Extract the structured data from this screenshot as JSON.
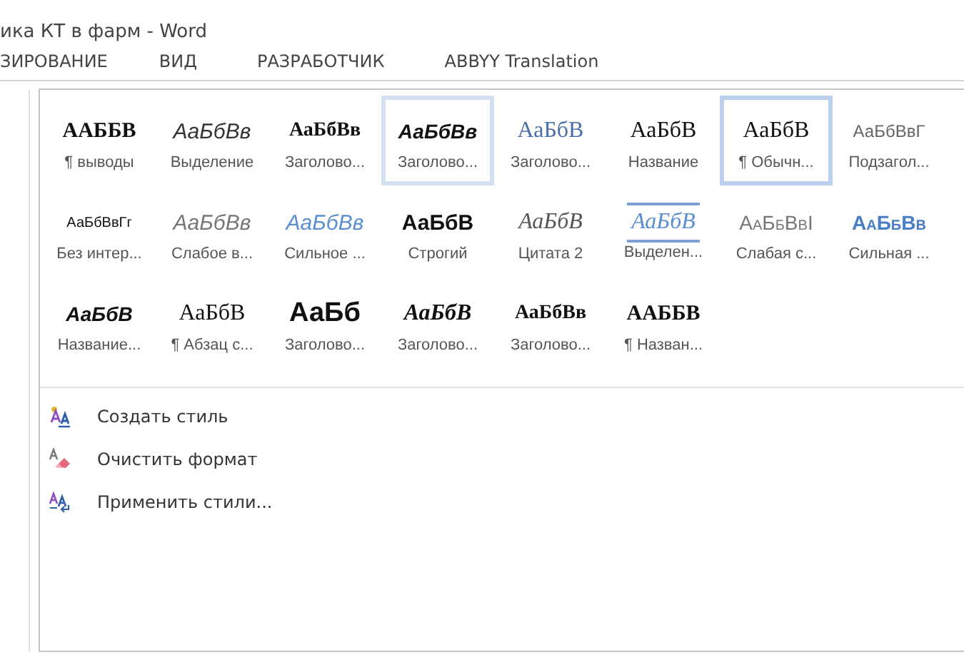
{
  "window": {
    "title": "ика КТ в фарм - Word"
  },
  "tabs": [
    {
      "label": "ЗИРОВАНИЕ",
      "selected": false
    },
    {
      "label": "ВИД",
      "selected": false
    },
    {
      "label": "РАЗРАБОТЧИК",
      "selected": false
    },
    {
      "label": "ABBYY Translation",
      "selected": false
    }
  ],
  "style_gallery": {
    "styles": [
      {
        "preview": "ААББВ",
        "label": "¶ выводы",
        "kind": "serifcaps",
        "selected": false,
        "hovered": false
      },
      {
        "preview": "АаБбВв",
        "label": "Выделение",
        "kind": "italic",
        "selected": false,
        "hovered": false
      },
      {
        "preview": "АаБбВв",
        "label": "Заголово...",
        "kind": "serifbold",
        "selected": false,
        "hovered": false
      },
      {
        "preview": "АаБбВв",
        "label": "Заголово...",
        "kind": "bolditalic",
        "selected": false,
        "hovered": true
      },
      {
        "preview": "АаБбВ",
        "label": "Заголово...",
        "kind": "serifblue",
        "selected": false,
        "hovered": false
      },
      {
        "preview": "АаБбВ",
        "label": "Название",
        "kind": "serif",
        "selected": false,
        "hovered": false
      },
      {
        "preview": "АаБбВ",
        "label": "¶ Обычн...",
        "kind": "serif",
        "selected": true,
        "hovered": false
      },
      {
        "preview": "АаБбВвГ",
        "label": "Подзагол...",
        "kind": "sansgrey",
        "selected": false,
        "hovered": false
      },
      {
        "preview": "АаБбВвГг",
        "label": "Без интер...",
        "kind": "sanssmall",
        "selected": false,
        "hovered": false
      },
      {
        "preview": "АаБбВв",
        "label": "Слабое в...",
        "kind": "greyitalic",
        "selected": false,
        "hovered": false
      },
      {
        "preview": "АаБбВв",
        "label": "Сильное ...",
        "kind": "blueitalic",
        "selected": false,
        "hovered": false
      },
      {
        "preview": "АаБбВ",
        "label": "Строгий",
        "kind": "sansbold",
        "selected": false,
        "hovered": false
      },
      {
        "preview": "АаБбВ",
        "label": "Цитата 2",
        "kind": "quote",
        "selected": false,
        "hovered": false
      },
      {
        "preview": "АаБбВ",
        "label": "Выделен...",
        "kind": "intensequote",
        "selected": false,
        "hovered": false
      },
      {
        "preview": "АаБбВвI",
        "label": "Слабая с...",
        "kind": "smallcaps",
        "selected": false,
        "hovered": false
      },
      {
        "preview": "АаБбВв",
        "label": "Сильная ...",
        "kind": "bluecaps",
        "selected": false,
        "hovered": false
      },
      {
        "preview": "АаБбВ",
        "label": "Название...",
        "kind": "bolditalic",
        "selected": false,
        "hovered": false
      },
      {
        "preview": "АаБбВ",
        "label": "¶ Абзац с...",
        "kind": "serif",
        "selected": false,
        "hovered": false
      },
      {
        "preview": "АаБб",
        "label": "Заголово...",
        "kind": "bigbold",
        "selected": false,
        "hovered": false
      },
      {
        "preview": "АаБбВ",
        "label": "Заголово...",
        "kind": "serifbolditalic",
        "selected": false,
        "hovered": false
      },
      {
        "preview": "АаБбВв",
        "label": "Заголово...",
        "kind": "serifbold",
        "selected": false,
        "hovered": false
      },
      {
        "preview": "ААББВ",
        "label": "¶ Назван...",
        "kind": "serifcaps",
        "selected": false,
        "hovered": false
      }
    ]
  },
  "menu": [
    {
      "label": "Создать стиль",
      "kind": "new"
    },
    {
      "label": "Очистить формат",
      "kind": "clear"
    },
    {
      "label": "Применить стили...",
      "kind": "apply"
    }
  ]
}
